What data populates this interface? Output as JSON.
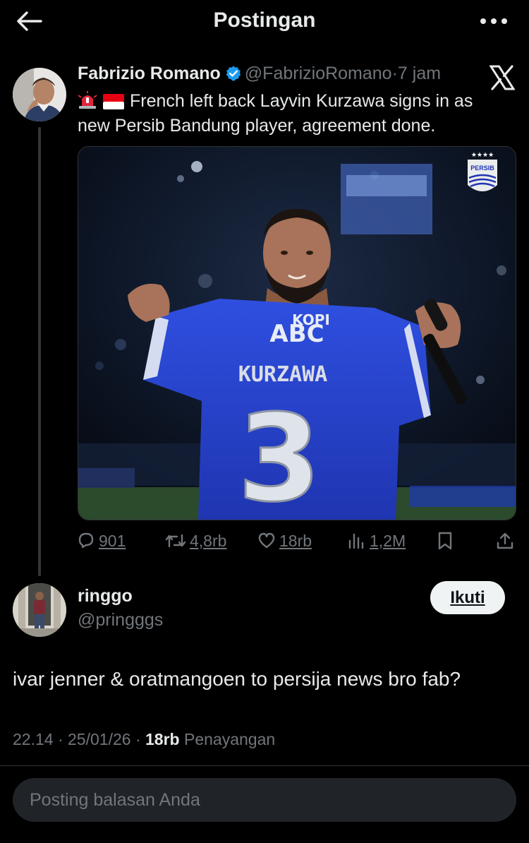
{
  "header": {
    "title": "Postingan"
  },
  "quoted_post": {
    "author_name": "Fabrizio Romano",
    "handle": "@FabrizioRomano",
    "separator": "·",
    "time": "7 jam",
    "text": "French left back Layvin Kurzawa signs in as new Persib Bandung player, agreement done.",
    "emojis": [
      "rotating-light-icon",
      "indonesia-flag-icon"
    ],
    "image": {
      "jersey_sponsor_small": "KOPI",
      "jersey_sponsor": "ABC",
      "jersey_name": "KURZAWA",
      "jersey_number": "3",
      "club_badge_text": "PERSIB"
    },
    "stats": {
      "replies": "901",
      "reposts": "4,8rb",
      "likes": "18rb",
      "views": "1,2M"
    }
  },
  "reply": {
    "author_name": "ringgo",
    "handle": "@pringggs",
    "follow_label": "Ikuti",
    "text": "ivar jenner & oratmangoen to persija news bro fab?",
    "time": "22.14",
    "date": "25/01/26",
    "views_count": "18rb",
    "views_label": "Penayangan",
    "separator": "·"
  },
  "composer": {
    "placeholder": "Posting balasan Anda"
  },
  "colors": {
    "background": "#000000",
    "text_primary": "#e7e9ea",
    "text_secondary": "#71767b",
    "verified": "#1d9bf0",
    "jersey_blue": "#2440c9"
  }
}
